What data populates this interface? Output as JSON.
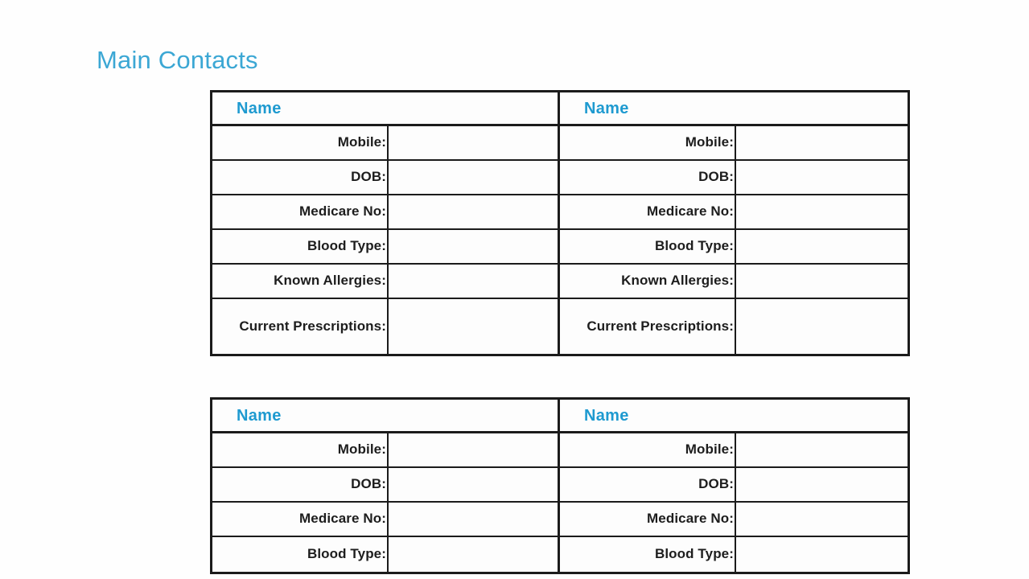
{
  "document": {
    "title": "Main Contacts",
    "title_color": "#3ba7d4",
    "background_color": "#ffffff",
    "border_color": "#1b1b1b",
    "name_header_color": "#1e9ad0"
  },
  "blocks": [
    {
      "id": "contact-block-1",
      "halves": [
        {
          "id": "contact-1",
          "name_header": "Name",
          "name_value": "",
          "fields": [
            {
              "label": "Mobile:",
              "value": ""
            },
            {
              "label": "DOB:",
              "value": ""
            },
            {
              "label": "Medicare No:",
              "value": ""
            },
            {
              "label": "Blood Type:",
              "value": ""
            },
            {
              "label": "Known Allergies:",
              "value": ""
            },
            {
              "label": "Current Prescriptions:",
              "value": ""
            }
          ]
        },
        {
          "id": "contact-2",
          "name_header": "Name",
          "name_value": "",
          "fields": [
            {
              "label": "Mobile:",
              "value": ""
            },
            {
              "label": "DOB:",
              "value": ""
            },
            {
              "label": "Medicare No:",
              "value": ""
            },
            {
              "label": "Blood Type:",
              "value": ""
            },
            {
              "label": "Known Allergies:",
              "value": ""
            },
            {
              "label": "Current Prescriptions:",
              "value": ""
            }
          ]
        }
      ]
    },
    {
      "id": "contact-block-2",
      "halves": [
        {
          "id": "contact-3",
          "name_header": "Name",
          "name_value": "",
          "fields": [
            {
              "label": "Mobile:",
              "value": ""
            },
            {
              "label": "DOB:",
              "value": ""
            },
            {
              "label": "Medicare No:",
              "value": ""
            },
            {
              "label": "Blood Type:",
              "value": ""
            }
          ]
        },
        {
          "id": "contact-4",
          "name_header": "Name",
          "name_value": "",
          "fields": [
            {
              "label": "Mobile:",
              "value": ""
            },
            {
              "label": "DOB:",
              "value": ""
            },
            {
              "label": "Medicare No:",
              "value": ""
            },
            {
              "label": "Blood Type:",
              "value": ""
            }
          ]
        }
      ]
    }
  ]
}
